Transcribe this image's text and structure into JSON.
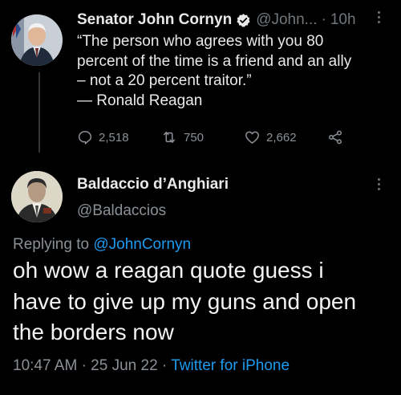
{
  "tweet1": {
    "author_name": "Senator John Cornyn",
    "handle": "@John...",
    "separator": "·",
    "time": "10h",
    "text_lines": [
      "“The person who agrees with you 80",
      "percent of the time is a friend and an ally",
      "– not a 20 percent traitor.”",
      "— Ronald Reagan"
    ],
    "replies": "2,518",
    "retweets": "750",
    "likes": "2,662"
  },
  "tweet2": {
    "author_name": "Baldaccio d’Anghiari",
    "handle": "@Baldaccios",
    "replying_label": "Replying to",
    "replying_handle": "@JohnCornyn",
    "text_lines": [
      "oh wow a reagan quote guess i",
      "have to give up my guns and open",
      "the borders now"
    ],
    "time": "10:47 AM",
    "dot1": "·",
    "date": "25 Jun 22",
    "dot2": "·",
    "source": "Twitter for iPhone"
  },
  "colors": {
    "background": "#000000",
    "text": "#e7e9ea",
    "muted": "#71767b",
    "link": "#1d9bf0"
  },
  "icons": [
    "verified-badge-icon",
    "more-icon",
    "reply-icon",
    "retweet-icon",
    "like-icon",
    "share-icon"
  ]
}
